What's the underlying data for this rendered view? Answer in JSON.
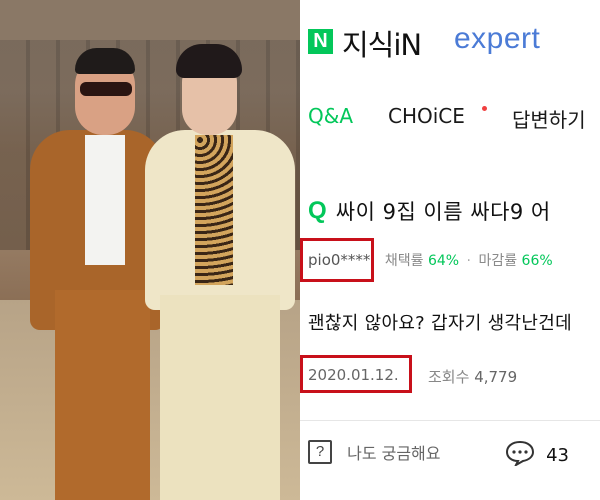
{
  "header": {
    "logo_letter": "N",
    "brand": "지식iN",
    "expert": "expert"
  },
  "tabs": [
    {
      "label": "Q&A",
      "active": true
    },
    {
      "label": "CHOiCE",
      "active": false,
      "has_new_dot": true
    },
    {
      "label": "답변하기",
      "active": false
    }
  ],
  "question": {
    "icon": "Q",
    "title": "싸이 9집 이름 싸다9 어",
    "user": "pio0****",
    "adoption_label": "채택률",
    "adoption_rate": "64%",
    "separator": "·",
    "deadline_label": "마감률",
    "deadline_rate": "66%",
    "body": "괜찮지 않아요? 갑자기 생각난건데",
    "date": "2020.01.12.",
    "views_label": "조회수",
    "views": "4,779"
  },
  "actions": {
    "curious_icon": "?",
    "curious_label": "나도 궁금해요",
    "comment_count": "43"
  },
  "colors": {
    "naver_green": "#03c75a",
    "expert_blue": "#4b7bd6",
    "highlight_red": "#c8101a"
  },
  "icons": {
    "logo": "naver-n-logo",
    "question": "q-icon",
    "curious": "question-box-icon",
    "comment": "speech-bubble-icon"
  }
}
